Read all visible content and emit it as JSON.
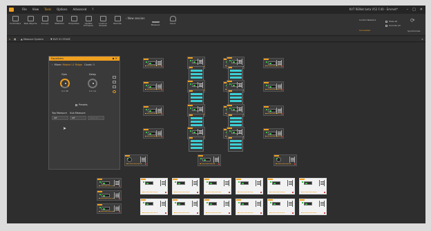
{
  "colors": {
    "accent": "#f0a020",
    "window_bg": "#2b2b2b",
    "channel_cyan": "#3ccfd6",
    "meter_green": "#39c04a"
  },
  "menu": {
    "items": [
      "File",
      "View",
      "Tools",
      "Options",
      "Advanced",
      "?"
    ]
  },
  "app": {
    "title": "KVT RENet beta V52 F.40 - Emmet*"
  },
  "window": {
    "minimize": "–",
    "maximize": "□",
    "close": "✕"
  },
  "ribbon": {
    "buttons": [
      {
        "label": "Controllers",
        "icon": "controllers-icon"
      },
      {
        "label": "New Objects",
        "icon": "new-objects-icon"
      },
      {
        "label": "Groups",
        "icon": "groups-icon"
      },
      {
        "label": "Statistics",
        "icon": "statistics-icon"
      },
      {
        "label": "Properties",
        "icon": "properties-icon"
      },
      {
        "label": "Update Firmware",
        "icon": "update-firmware-icon"
      },
      {
        "label": "Licence Presets",
        "icon": "licence-presets-icon"
      },
      {
        "label": "Remote",
        "icon": "remote-icon"
      },
      {
        "label": "Measure",
        "icon": "measure-icon"
      },
      {
        "label": "Cloud",
        "icon": "cloud-icon"
      }
    ],
    "new_session": "New session",
    "right": {
      "control_label": "Control Network",
      "mute_all": "Mute All",
      "unmute_all": "Unmute All",
      "link_label": "Connected",
      "sync_label": "Synchronize"
    }
  },
  "tabs": [
    {
      "label": "Measure System"
    },
    {
      "label": "KVS 51 STAGE"
    }
  ],
  "panel": {
    "title": "Equalizers",
    "mixer_label": "Mixer:",
    "mixer_value": "Master L1 Ridge",
    "count_label": "Count: 1",
    "gain_label": "Gain",
    "delay_label": "Delay",
    "gain_value": "0.0",
    "gain_unit": "dB",
    "delay_value": "0.0",
    "delay_unit": "ms",
    "presets_label": "Presets",
    "top_measure_label": "Top Measure",
    "sub_measure_label": "Sub Measure",
    "top_measure_value": "Off",
    "sub_measure_value": "Off",
    "apply_label": "Save as..."
  }
}
